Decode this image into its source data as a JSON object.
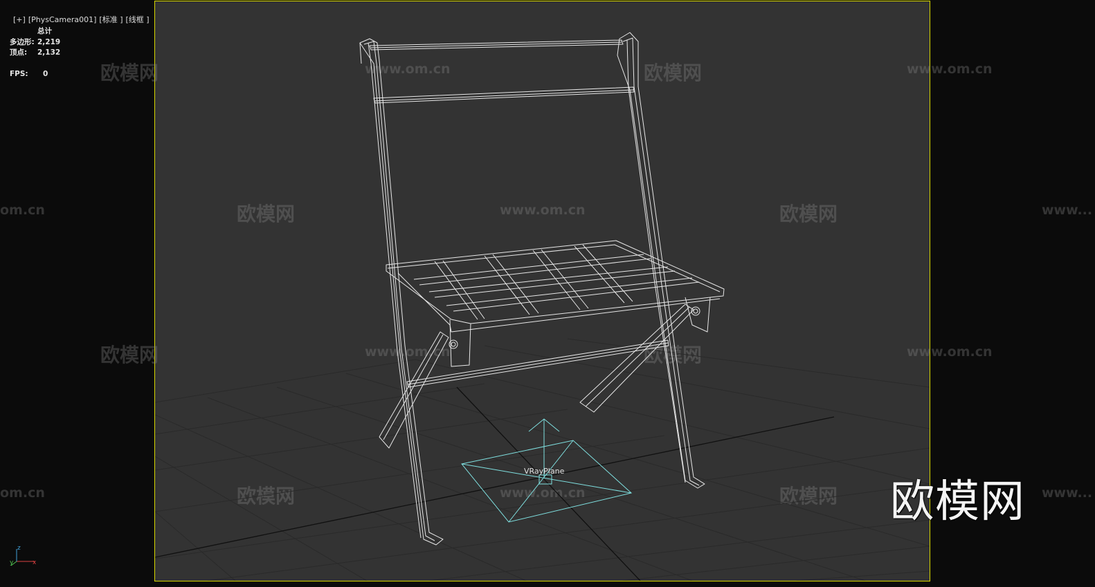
{
  "viewport": {
    "label_items": [
      "[+]",
      "[PhysCamera001]",
      "[标准 ]",
      "[线框 ]"
    ]
  },
  "stats": {
    "header": "总计",
    "rows": [
      {
        "label": "多边形:",
        "value": "2,219"
      },
      {
        "label": "顶点:",
        "value": "2,132"
      },
      {
        "label": "FPS:",
        "value": "0"
      }
    ]
  },
  "object_label": "VRayPlane",
  "gizmo": {
    "x": "x",
    "y": "y",
    "z": "z"
  },
  "watermark": {
    "cn": "欧模网",
    "url": "www.om.cn",
    "url_partial_left": "om.cn",
    "url_partial_right": "www..."
  },
  "logo": "欧模网",
  "colors": {
    "frame": "#d8d800",
    "viewport_bg": "#333333",
    "outer_bg": "#0b0b0b",
    "wire": "#e8e8e8",
    "plane": "#7fe0e0"
  }
}
